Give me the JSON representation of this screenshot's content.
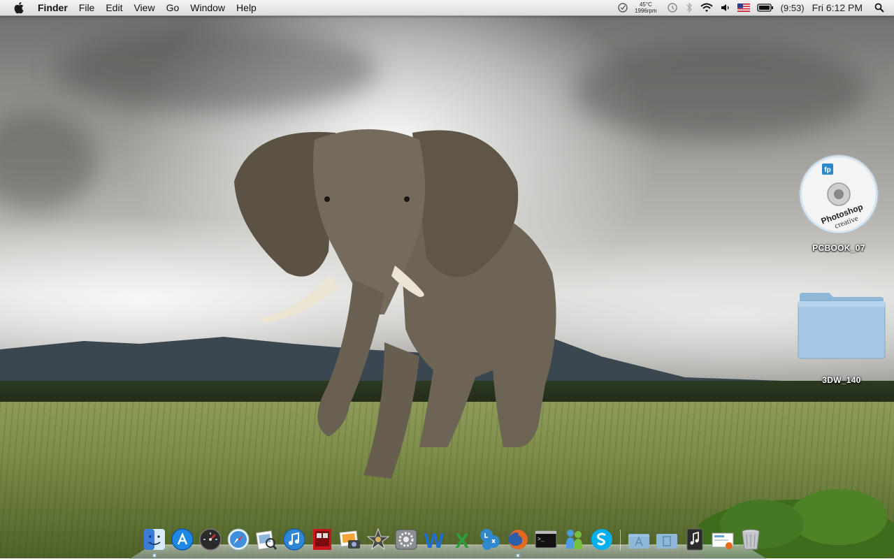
{
  "menubar": {
    "app_name": "Finder",
    "menus": [
      "File",
      "Edit",
      "View",
      "Go",
      "Window",
      "Help"
    ]
  },
  "status": {
    "cpu_temp": "45°C",
    "fan_speed": "1996rpm",
    "battery_time": "(9:53)",
    "clock": "Fri 6:12 PM",
    "icons": [
      "istat-menus-icon",
      "time-machine-icon",
      "bluetooth-icon",
      "wifi-icon",
      "volume-icon",
      "us-flag-input-icon",
      "battery-icon",
      "spotlight-icon"
    ]
  },
  "desktop": {
    "items": [
      {
        "label": "PCBOOK_07",
        "type": "disc"
      },
      {
        "label": "3DW_140",
        "type": "folder"
      }
    ],
    "disc_art": {
      "brand": "fp",
      "title": "Photoshop",
      "subtitle": "creative"
    }
  },
  "dock": {
    "apps": [
      "Finder",
      "App Store",
      "Dashboard",
      "Safari",
      "Preview",
      "iTunes",
      "Photo Booth",
      "iPhoto",
      "iMovie",
      "System Preferences",
      "Microsoft Word",
      "Microsoft Excel",
      "Twitter",
      "Firefox",
      "Terminal",
      "Messenger",
      "Skype"
    ],
    "stacks": [
      "Applications",
      "Documents",
      "iTunes Music",
      "Downloads",
      "Trash"
    ],
    "icon_glyphs": {
      "word": "W",
      "excel": "X",
      "terminal": ">_"
    },
    "colors": {
      "finder": "#3a7bd5",
      "appstore": "#1e88e5",
      "skype": "#00aff0",
      "excel": "#2e9e3f",
      "word": "#1f6fd1"
    }
  }
}
